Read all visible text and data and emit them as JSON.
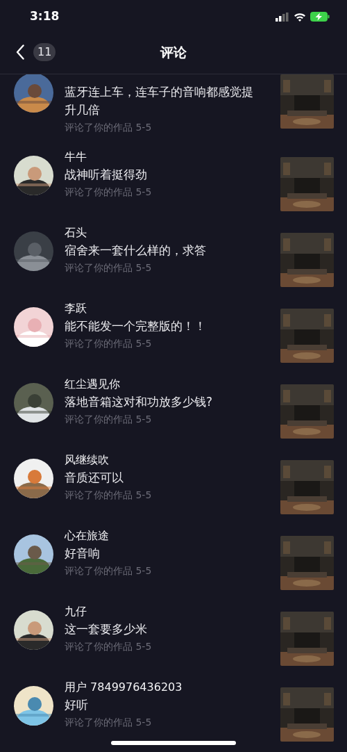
{
  "status_bar": {
    "time": "3:18"
  },
  "header": {
    "title": "评论",
    "unread_count": "11"
  },
  "comments": [
    {
      "comment": "蓝牙连上车，连车子的音响都感觉提升几倍",
      "meta": "评论了你的作品  5-5"
    },
    {
      "name": "牛牛",
      "comment": "战神听着挺得劲",
      "meta": "评论了你的作品  5-5"
    },
    {
      "name": "石头",
      "comment": "宿舍来一套什么样的，求答",
      "meta": "评论了你的作品  5-5"
    },
    {
      "name": "李跃",
      "comment": "能不能发一个完整版的！！",
      "meta": "评论了你的作品  5-5"
    },
    {
      "name": "红尘遇见你",
      "comment": "落地音箱这对和功放多少钱?",
      "meta": "评论了你的作品  5-5"
    },
    {
      "name": "风继续吹",
      "comment": "音质还可以",
      "meta": "评论了你的作品  5-5"
    },
    {
      "name": "心在旅途",
      "comment": "好音响",
      "meta": "评论了你的作品  5-5"
    },
    {
      "name": "九仔",
      "comment": "这一套要多少米",
      "meta": "评论了你的作品  5-5"
    },
    {
      "name": "用户 7849976436203",
      "comment": "好听",
      "meta": "评论了你的作品  5-5"
    }
  ]
}
